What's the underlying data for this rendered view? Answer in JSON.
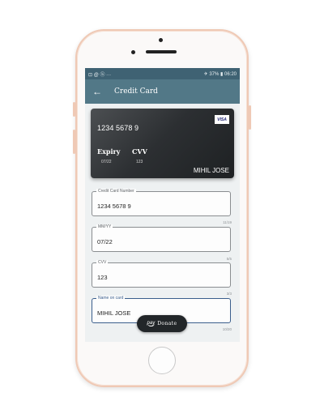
{
  "status_bar": {
    "left_icons": [
      "image-icon",
      "at-icon",
      "circle-icon",
      "more-icon"
    ],
    "left_text": "⊡ @ ⓑ ···",
    "right_text": "✈ 37% ▮ 06:20"
  },
  "appbar": {
    "title": "Credit Card",
    "back_icon": "arrow-back-icon"
  },
  "card": {
    "number": "1234 5678 9",
    "brand": "VISA",
    "expiry_label": "Expiry",
    "expiry_value": "07/22",
    "cvv_label": "CVV",
    "cvv_value": "123",
    "holder": "MIHIL JOSE"
  },
  "form": {
    "card_number": {
      "label": "Credit Card Number",
      "value": "1234 5678 9",
      "counter": "11/19"
    },
    "expiry": {
      "label": "MM/YY",
      "value": "07/22",
      "counter": "5/5"
    },
    "cvv": {
      "label": "CVV",
      "value": "123",
      "counter": "3/3"
    },
    "name": {
      "label": "Name on card",
      "value": "MIHIL JOSE",
      "counter": "10/20"
    }
  },
  "donate_button": {
    "pay_text": "pay",
    "label": "Donate"
  },
  "colors": {
    "primary": "#527887",
    "status_bar": "#3f6273",
    "focus": "#3a5e8c",
    "phone_frame": "#efc9b5"
  }
}
